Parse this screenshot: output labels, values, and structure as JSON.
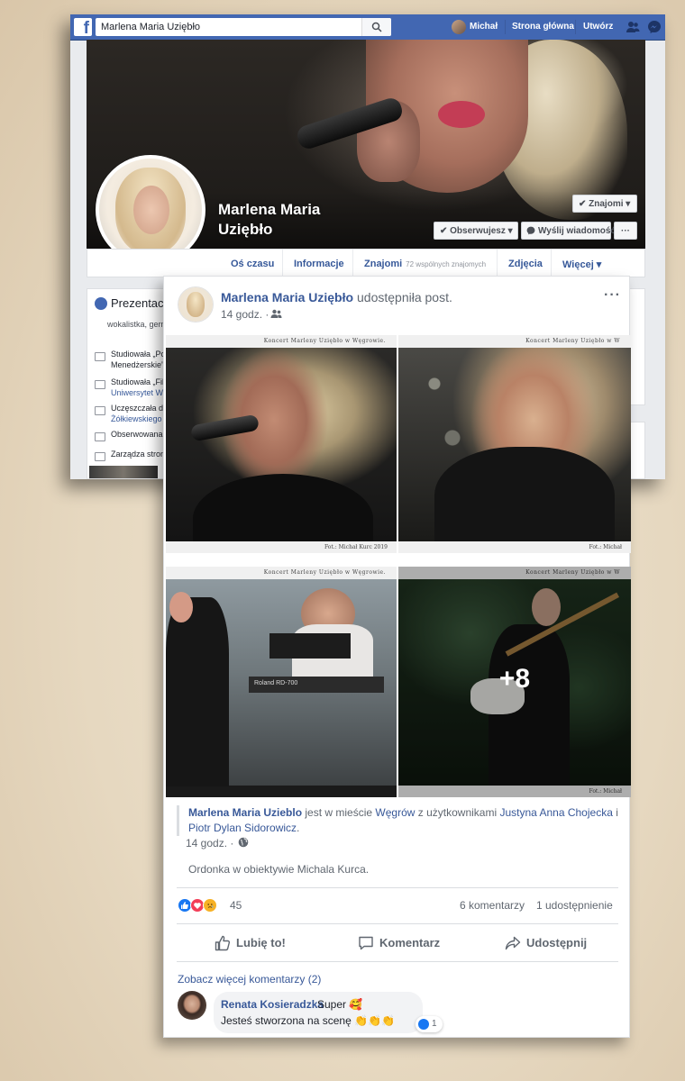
{
  "colors": {
    "fb_blue": "#4267b2",
    "link": "#385898",
    "text_secondary": "#606770",
    "like": "#1877f2",
    "love": "#f33e58",
    "sad": "#f7b125"
  },
  "topbar": {
    "search_value": "Marlena Maria Uziębło",
    "user": "Michał",
    "home": "Strona główna",
    "create": "Utwórz",
    "icons": [
      "facebook-logo",
      "search-icon",
      "friends-icon",
      "messenger-icon"
    ]
  },
  "profile": {
    "name_line1": "Marlena Maria",
    "name_line2": "Uziębło",
    "buttons": {
      "friends": "✔ Znajomi ▾",
      "follow": "✔ Obserwujesz ▾",
      "message": "Wyślij wiadomość",
      "more": "···"
    },
    "tabs": {
      "timeline": "Oś czasu",
      "about": "Informacje",
      "friends": "Znajomi",
      "friends_sub": "72 wspólnych znajomych",
      "photos": "Zdjęcia",
      "more": "Więcej ▾"
    },
    "intro": {
      "heading": "Prezentacja",
      "bio": "wokalistka, germ",
      "lines": [
        {
          "text": "Studiowała „Po",
          "sub": "Menedżerskie”"
        },
        {
          "text": "Studiowała „Fil",
          "sub": "Uniwersytet Wa"
        },
        {
          "text": "Uczęszczała d",
          "sub": "Żółkiewskiego"
        },
        {
          "text": "Obserwowana",
          "sub": ""
        },
        {
          "text": "Zarządza stron",
          "sub": ""
        }
      ]
    }
  },
  "post": {
    "author": "Marlena Maria Uziębło",
    "action": "udostępniła post.",
    "time": "14 godz. ·",
    "more": "···",
    "photos": [
      {
        "banner": "Koncert Marleny Uziębło w Węgrowie.",
        "credit": "Fot.: Michał Kurc 2019"
      },
      {
        "banner": "Koncert Marleny Uziębło w W",
        "credit": "Fot.: Michał"
      },
      {
        "banner": "Koncert Marleny Uziębło w Węgrowie.",
        "credit": ""
      },
      {
        "banner": "Koncert Marleny Uziębło w W",
        "credit": "Fot.: Michał"
      }
    ],
    "more_photos": "+8",
    "shared": {
      "author": "Marlena Maria Uzieblo",
      "is_in": " jest w mieście ",
      "place": "Węgrów",
      "with": " z użytkownikami ",
      "user1": "Justyna Anna Chojecka",
      "and": " i",
      "user2": "Piotr Dylan Sidorowicz",
      ".": ".",
      "time": "14 godz. ·",
      "caption": "Ordonka w obiektywie Michala Kurca."
    },
    "reactions_count": "45",
    "comments": "6 komentarzy",
    "shares": "1 udostępnienie",
    "actions": {
      "like": "Lubię to!",
      "comment": "Komentarz",
      "share": "Udostępnij"
    },
    "see_more": "Zobacz więcej komentarzy (2)",
    "comment": {
      "name": "Renata Kosieradzka",
      "text1": "Super 🥰",
      "text2": "Jesteś stworzona na scenę 👏👏👏",
      "likes": "1"
    }
  }
}
